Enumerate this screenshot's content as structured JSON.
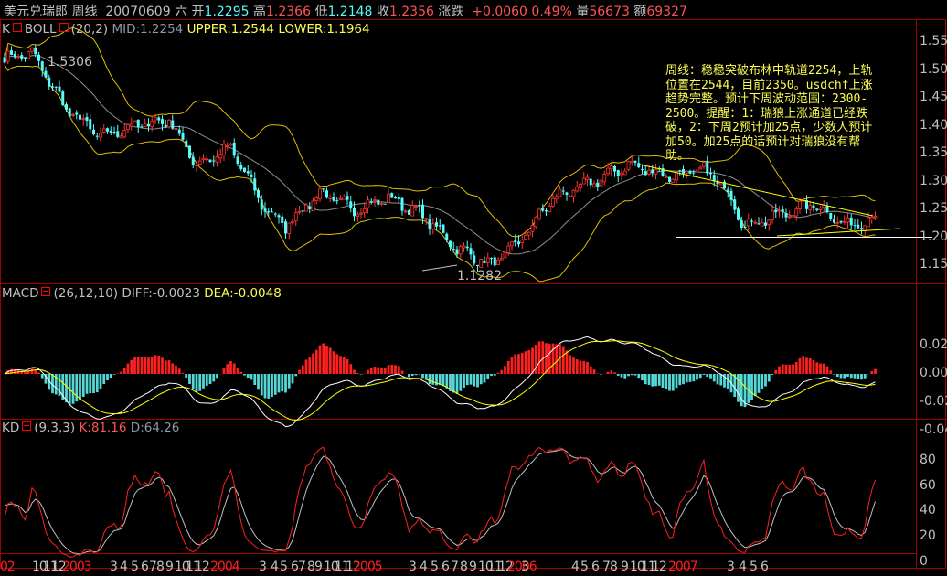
{
  "header": {
    "symbol": "美元兑瑞郎",
    "period": "周线",
    "date": "20070609",
    "weekday": "六",
    "open_label": "开",
    "open": "1.2295",
    "high_label": "高",
    "high": "1.2366",
    "low_label": "低",
    "low": "1.2148",
    "close_label": "收",
    "close": "1.2356",
    "change_label": "涨跌",
    "change": "+0.0060",
    "change_pct": "0.49%",
    "volume_label": "量",
    "volume": "56673",
    "amount_label": "额",
    "amount": "69327"
  },
  "price_panel": {
    "k_label": "K",
    "indicator": "BOLL",
    "params": "(20,2)",
    "mid": "MID:1.2254",
    "upper": "UPPER:1.2544",
    "lower": "LOWER:1.1964",
    "high_mark": "1.5306",
    "low_mark": "1.1282",
    "y_ticks": [
      "1.550",
      "1.500",
      "1.450",
      "1.400",
      "1.350",
      "1.300",
      "1.250",
      "1.200",
      "1.150"
    ]
  },
  "annotation": "周线：稳稳突破布林中轨道2254，上轨位置在2544，目前2350。usdchf上涨趋势完整。预计下周波动范围：2300-2500。提醒：1：瑞狼上涨通道已经跌破，2：下周2预计加25点，少数人预计加50。加25点的话预计对瑞狼没有帮助。",
  "macd_panel": {
    "indicator": "MACD",
    "params": "(26,12,10)",
    "diff": "DIFF:-0.0023",
    "dea": "DEA:-0.0048",
    "y_ticks": [
      "0.020",
      "0.000",
      "-0.020",
      "-0.040"
    ]
  },
  "kd_panel": {
    "indicator": "KD",
    "params": "(9,3,3)",
    "k": "K:81.16",
    "d": "D:64.26",
    "y_ticks": [
      "80",
      "60",
      "40",
      "20",
      "0"
    ]
  },
  "x_axis": [
    {
      "t": "02",
      "red": true
    },
    {
      "t": "10",
      "red": false
    },
    {
      "t": "11",
      "red": false
    },
    {
      "t": "12",
      "red": false
    },
    {
      "t": "2003",
      "red": true
    },
    {
      "t": "3",
      "red": false
    },
    {
      "t": "4",
      "red": false
    },
    {
      "t": "5",
      "red": false
    },
    {
      "t": "6",
      "red": false
    },
    {
      "t": "7",
      "red": false
    },
    {
      "t": "8",
      "red": false
    },
    {
      "t": "9",
      "red": false
    },
    {
      "t": "10",
      "red": false
    },
    {
      "t": "11",
      "red": false
    },
    {
      "t": "12",
      "red": false
    },
    {
      "t": "2004",
      "red": true
    },
    {
      "t": "3",
      "red": false
    },
    {
      "t": "4",
      "red": false
    },
    {
      "t": "5",
      "red": false
    },
    {
      "t": "6",
      "red": false
    },
    {
      "t": "7",
      "red": false
    },
    {
      "t": "8",
      "red": false
    },
    {
      "t": "9",
      "red": false
    },
    {
      "t": "10",
      "red": false
    },
    {
      "t": "11",
      "red": false
    },
    {
      "t": "12",
      "red": false
    },
    {
      "t": "2005",
      "red": true
    },
    {
      "t": "3",
      "red": false
    },
    {
      "t": "4",
      "red": false
    },
    {
      "t": "5",
      "red": false
    },
    {
      "t": "6",
      "red": false
    },
    {
      "t": "7",
      "red": false
    },
    {
      "t": "8",
      "red": false
    },
    {
      "t": "9",
      "red": false
    },
    {
      "t": "10",
      "red": false
    },
    {
      "t": "11",
      "red": false
    },
    {
      "t": "12",
      "red": false
    },
    {
      "t": "2006",
      "red": true
    },
    {
      "t": "3",
      "red": false
    },
    {
      "t": "4",
      "red": false
    },
    {
      "t": "5",
      "red": false
    },
    {
      "t": "6",
      "red": false
    },
    {
      "t": "7",
      "red": false
    },
    {
      "t": "8",
      "red": false
    },
    {
      "t": "9",
      "red": false
    },
    {
      "t": "10",
      "red": false
    },
    {
      "t": "11",
      "red": false
    },
    {
      "t": "12",
      "red": false
    },
    {
      "t": "2007",
      "red": true
    },
    {
      "t": "3",
      "red": false
    },
    {
      "t": "4",
      "red": false
    },
    {
      "t": "5",
      "red": false
    },
    {
      "t": "6",
      "red": false
    }
  ],
  "chart_data": {
    "type": "candlestick",
    "title": "美元兑瑞郎 周线",
    "close_anchors": [
      [
        0,
        1.52
      ],
      [
        8,
        1.53
      ],
      [
        18,
        1.43
      ],
      [
        28,
        1.38
      ],
      [
        38,
        1.4
      ],
      [
        48,
        1.41
      ],
      [
        56,
        1.33
      ],
      [
        66,
        1.36
      ],
      [
        76,
        1.25
      ],
      [
        82,
        1.22
      ],
      [
        92,
        1.28
      ],
      [
        102,
        1.25
      ],
      [
        112,
        1.27
      ],
      [
        122,
        1.24
      ],
      [
        132,
        1.18
      ],
      [
        142,
        1.15
      ],
      [
        150,
        1.19
      ],
      [
        160,
        1.27
      ],
      [
        172,
        1.3
      ],
      [
        182,
        1.33
      ],
      [
        194,
        1.31
      ],
      [
        204,
        1.32
      ],
      [
        210,
        1.29
      ],
      [
        216,
        1.22
      ],
      [
        226,
        1.24
      ],
      [
        236,
        1.26
      ],
      [
        246,
        1.22
      ],
      [
        254,
        1.236
      ]
    ],
    "ylim_price": [
      1.13,
      1.56
    ],
    "ylim_macd": [
      -0.045,
      0.03
    ],
    "ylim_kd": [
      0,
      100
    ],
    "colors": {
      "up": "#ff3232",
      "down": "#54fcfc",
      "boll_band": "#e0c000",
      "mid": "#909090",
      "diff": "#ffffff",
      "dea": "#ffff00",
      "k": "#ff2020",
      "d": "#c0c0c0"
    }
  }
}
